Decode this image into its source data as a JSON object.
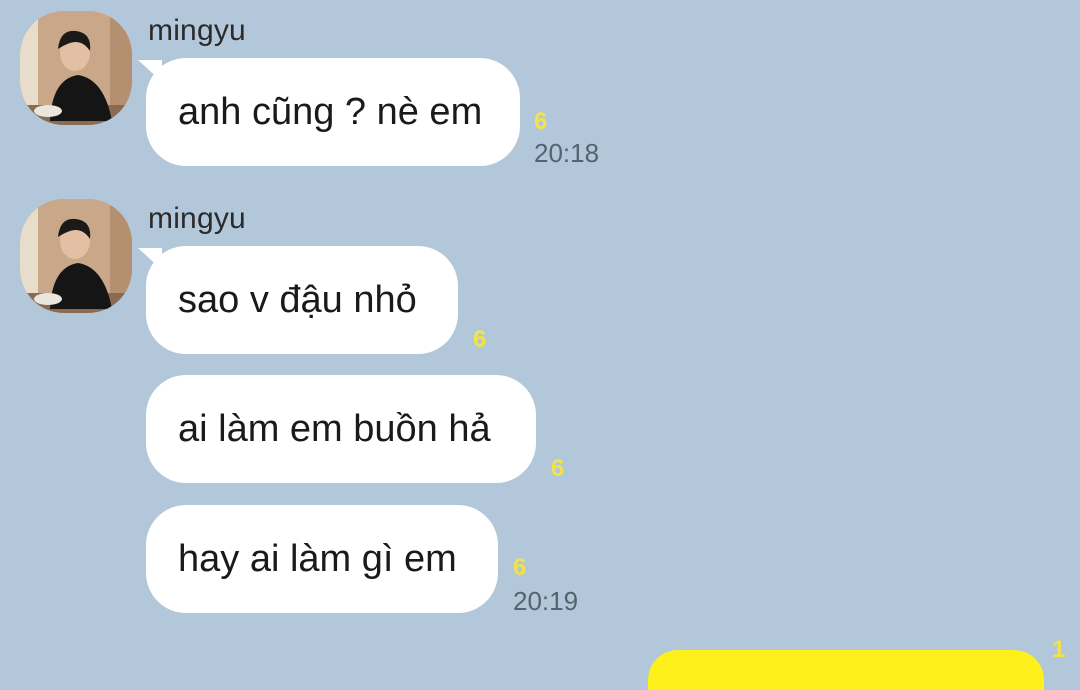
{
  "messages": [
    {
      "sender": "mingyu",
      "text": "anh cũng ? nè em",
      "unread": "6",
      "time": "20:18"
    },
    {
      "sender": "mingyu",
      "text": "sao v đậu nhỏ",
      "unread": "6"
    },
    {
      "text": "ai làm em buồn hả",
      "unread": "6"
    },
    {
      "text": "hay ai làm gì em",
      "unread": "6",
      "time": "20:19"
    }
  ],
  "outgoing_peek": {
    "unread": "1"
  },
  "colors": {
    "background": "#b2c7d9",
    "incoming_bubble": "#ffffff",
    "outgoing_bubble": "#fef01b",
    "unread_count": "#f2e34a",
    "timestamp": "#56636f"
  },
  "icons": {
    "avatar": "profile-photo"
  }
}
